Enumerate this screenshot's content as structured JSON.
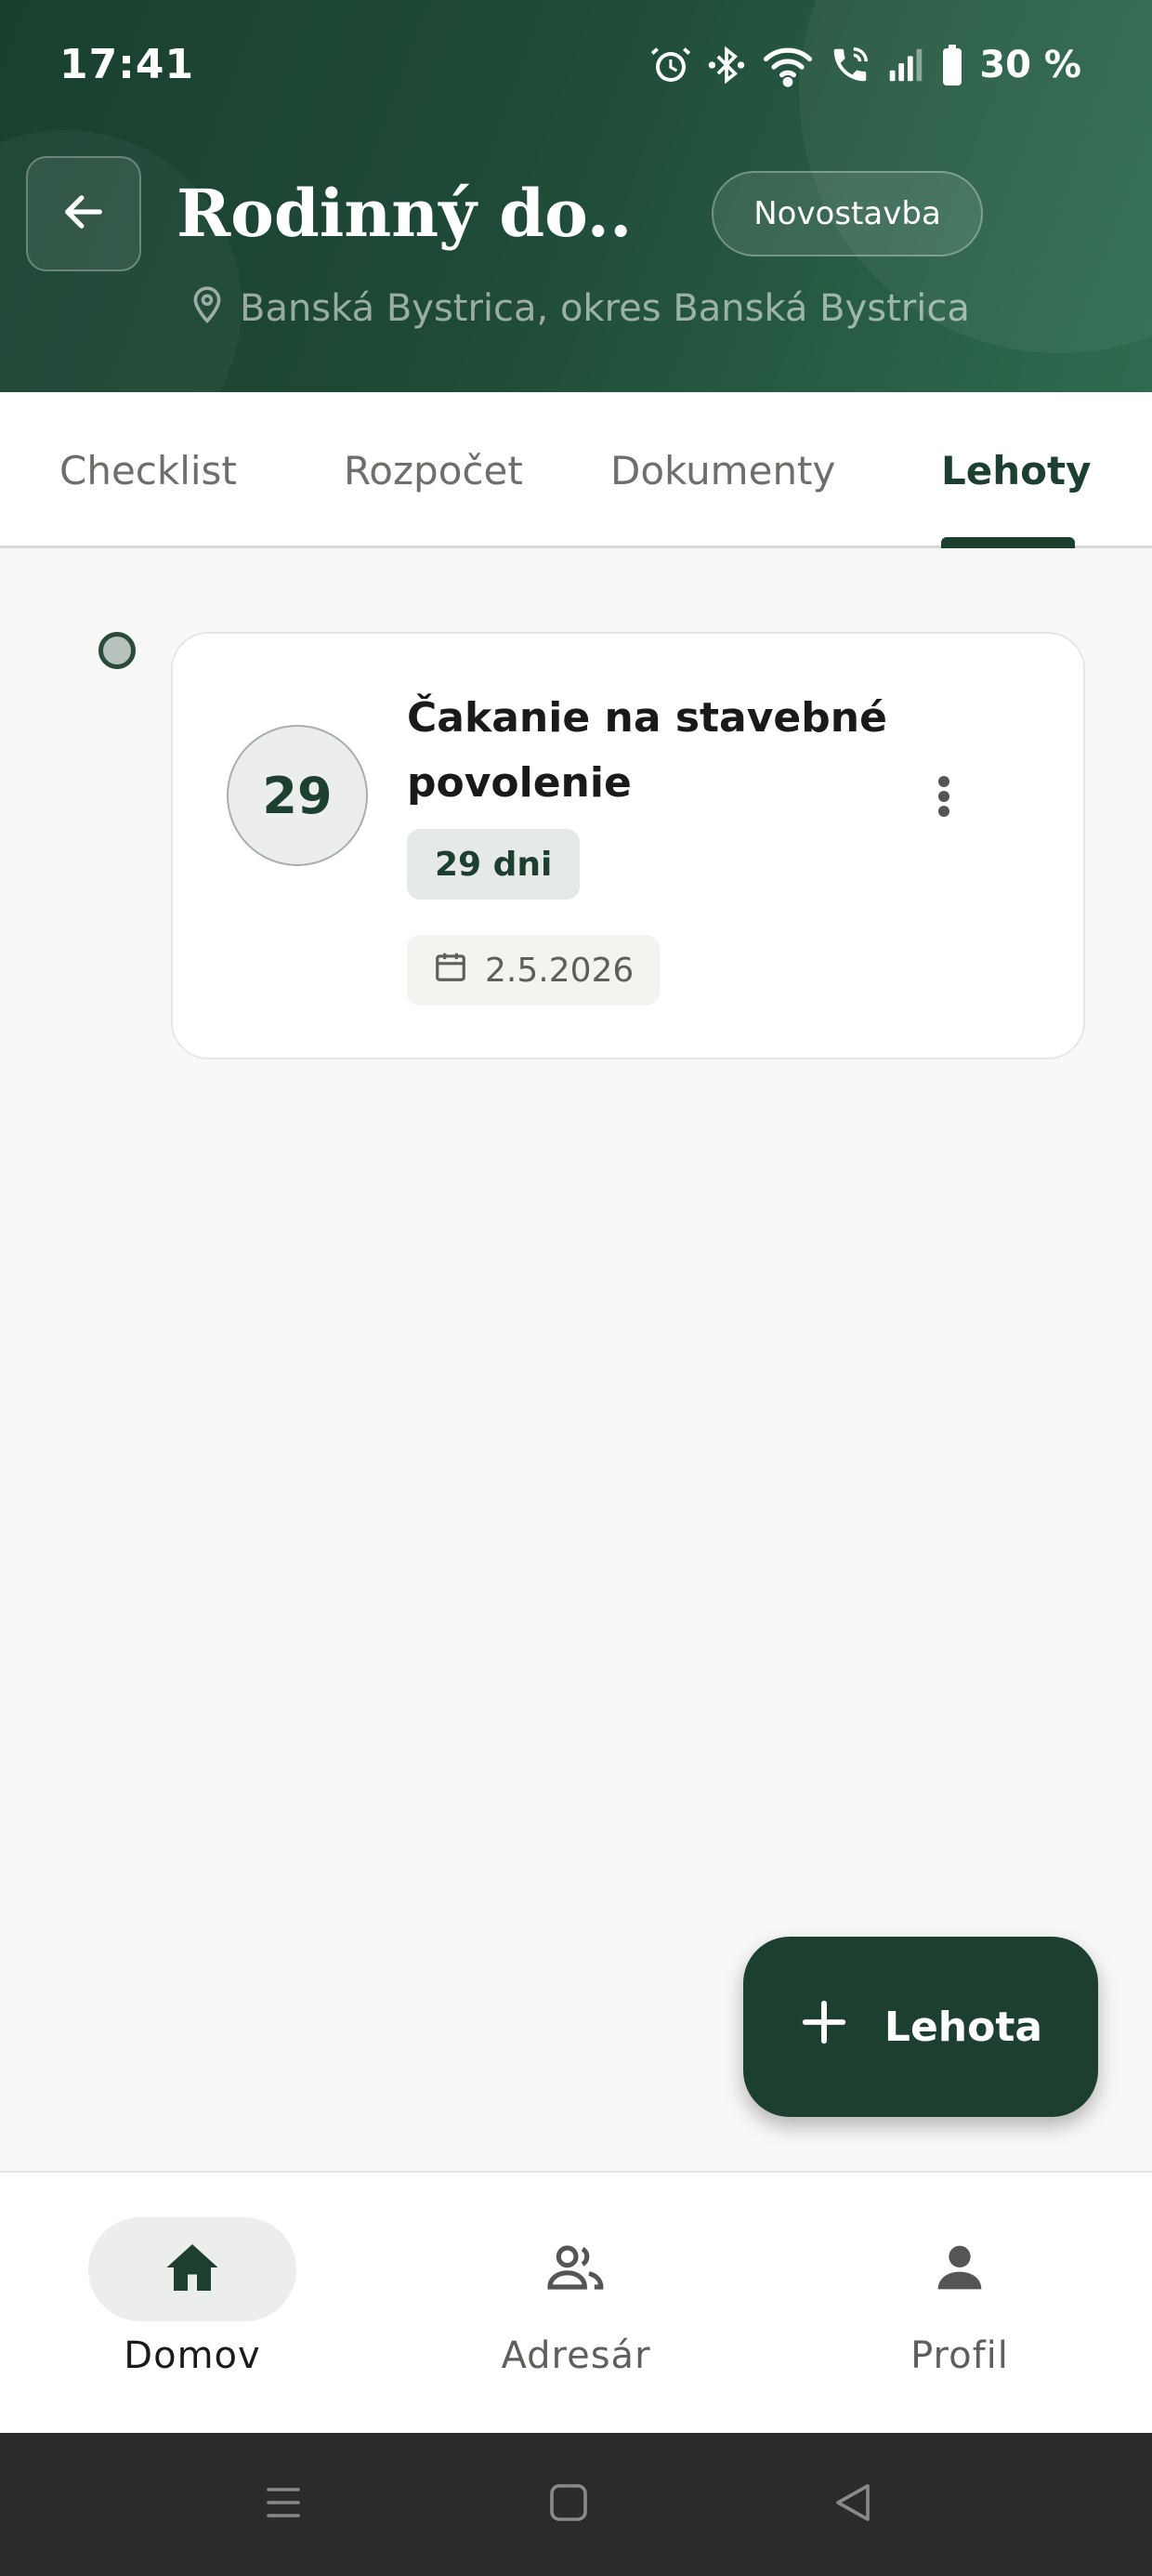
{
  "status_bar": {
    "time": "17:41",
    "battery": "30 %",
    "icons": [
      "alarm-icon",
      "bluetooth-icon",
      "wifi-icon",
      "wifi-call-icon",
      "signal-icon",
      "battery-icon"
    ]
  },
  "header": {
    "title": "Rodinný do...",
    "badge": "Novostavba",
    "location": "Banská Bystrica, okres Banská Bystrica",
    "colors": {
      "primary": "#1C3F2F",
      "gradient_end": "#2F6B50"
    }
  },
  "tabs": [
    {
      "label": "Checklist",
      "active": false
    },
    {
      "label": "Rozpočet",
      "active": false
    },
    {
      "label": "Dokumenty",
      "active": false
    },
    {
      "label": "Lehoty",
      "active": true
    }
  ],
  "deadlines": [
    {
      "days_number": "29",
      "title": "Čakanie na stavebné povolenie",
      "days_label": "29 dni",
      "date": "2.5.2026"
    }
  ],
  "fab": {
    "label": "Lehota",
    "icon": "plus-icon"
  },
  "bottom_nav": [
    {
      "label": "Domov",
      "icon": "home-icon",
      "active": true
    },
    {
      "label": "Adresár",
      "icon": "contacts-icon",
      "active": false
    },
    {
      "label": "Profil",
      "icon": "person-icon",
      "active": false
    }
  ]
}
